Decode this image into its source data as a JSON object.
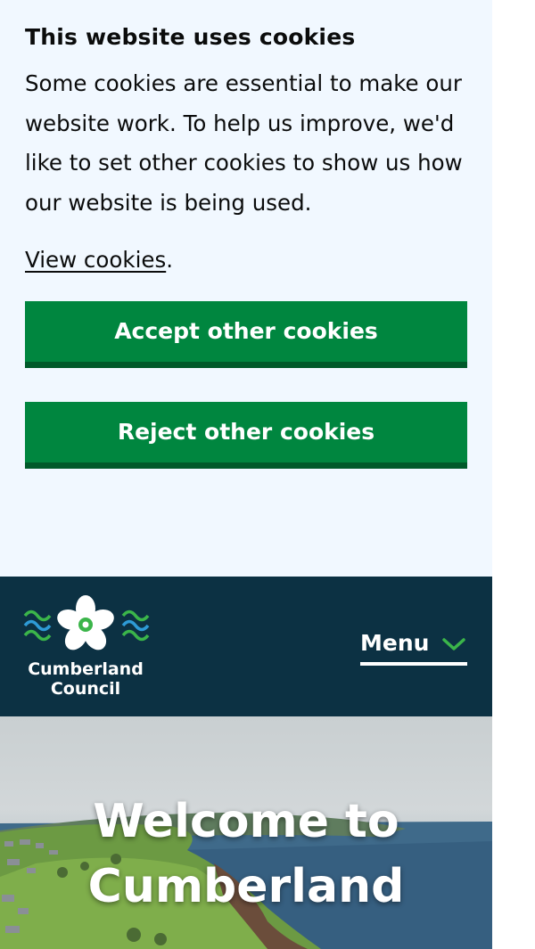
{
  "cookie_banner": {
    "title": "This website uses cookies",
    "body": "Some cookies are essential to make our website work. To help us improve, we'd like to set other cookies to show us how our website is being used.",
    "view_link": "View cookies",
    "view_suffix": ".",
    "accept_label": "Accept other cookies",
    "reject_label": "Reject other cookies"
  },
  "header": {
    "logo_line1": "Cumberland",
    "logo_line2": "Council",
    "menu_label": "Menu",
    "menu_icon": "chevron-down-icon"
  },
  "hero": {
    "heading_line1": "Welcome to",
    "heading_line2": "Cumberland"
  },
  "colors": {
    "banner_bg": "#f1f8ff",
    "button_green": "#00863f",
    "button_shadow": "#005a2a",
    "header_bg": "#0c3143",
    "accent_green": "#3bb54a"
  }
}
